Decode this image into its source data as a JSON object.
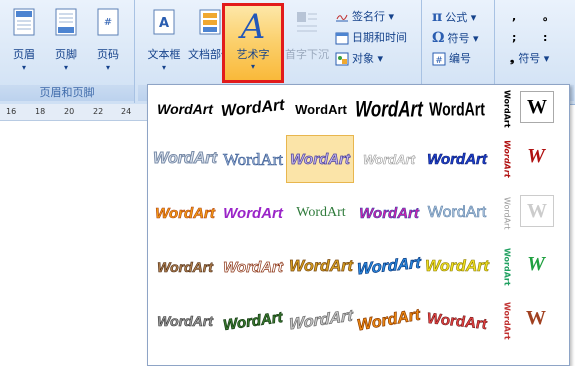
{
  "ribbon": {
    "groups": {
      "header_footer_label": "页眉和页脚"
    },
    "buttons": {
      "header": "页眉",
      "footer": "页脚",
      "page_number": "页码",
      "text_box": "文本框",
      "quick_parts": "文档部件",
      "wordart": "艺术字",
      "drop_cap": "首字下沉"
    },
    "small_buttons": {
      "signature_line": "签名行",
      "date_time": "日期和时间",
      "object": "对象",
      "equation": "公式",
      "symbol": "符号",
      "number": "编号",
      "special_symbol": "符号"
    },
    "symbols_grid": [
      ",",
      "。",
      ";",
      ":",
      "?",
      "!"
    ]
  },
  "ruler": {
    "ticks": [
      "16",
      "18",
      "20",
      "22",
      "24"
    ]
  },
  "gallery": {
    "sample_text": "WordArt",
    "side_glyph": "W",
    "selected_index": 8,
    "styles_rows": 5,
    "styles_cols": 5
  }
}
